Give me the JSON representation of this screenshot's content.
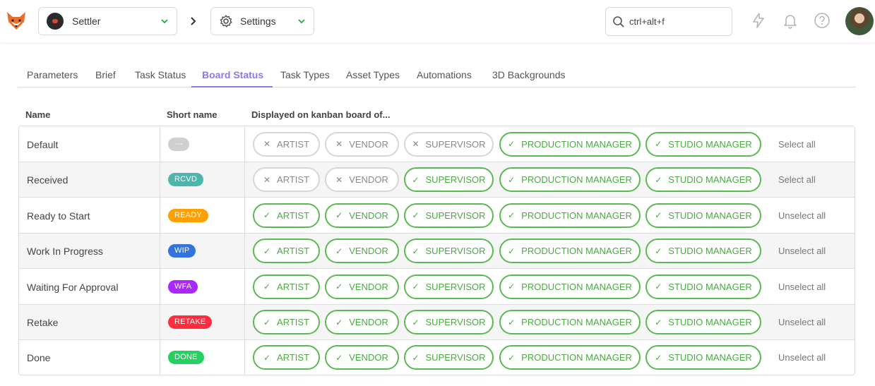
{
  "topbar": {
    "production": "Settler",
    "section": "Settings",
    "search_placeholder": "ctrl+alt+f"
  },
  "tabs": [
    "Parameters",
    "Brief",
    "Task Status",
    "Board Status",
    "Task Types",
    "Asset Types",
    "Automations",
    "3D Backgrounds"
  ],
  "active_tab": "Board Status",
  "table": {
    "headers": {
      "name": "Name",
      "short": "Short name",
      "kanban": "Displayed on kanban board of..."
    },
    "roles": [
      "ARTIST",
      "VENDOR",
      "SUPERVISOR",
      "PRODUCTION MANAGER",
      "STUDIO MANAGER"
    ],
    "rows": [
      {
        "name": "Default",
        "short": "---",
        "color": "#cfcfcf",
        "enabled": [
          false,
          false,
          false,
          true,
          true
        ],
        "action": "Select all"
      },
      {
        "name": "Received",
        "short": "RCVD",
        "color": "#4db6ac",
        "enabled": [
          false,
          false,
          true,
          true,
          true
        ],
        "action": "Select all"
      },
      {
        "name": "Ready to Start",
        "short": "READY",
        "color": "#ff9f00",
        "enabled": [
          true,
          true,
          true,
          true,
          true
        ],
        "action": "Unselect all"
      },
      {
        "name": "Work In Progress",
        "short": "WIP",
        "color": "#3273dc",
        "enabled": [
          true,
          true,
          true,
          true,
          true
        ],
        "action": "Unselect all"
      },
      {
        "name": "Waiting For Approval",
        "short": "WFA",
        "color": "#ab26ff",
        "enabled": [
          true,
          true,
          true,
          true,
          true
        ],
        "action": "Unselect all"
      },
      {
        "name": "Retake",
        "short": "RETAKE",
        "color": "#ff2d3d",
        "enabled": [
          true,
          true,
          true,
          true,
          true
        ],
        "action": "Unselect all"
      },
      {
        "name": "Done",
        "short": "DONE",
        "color": "#22d160",
        "enabled": [
          true,
          true,
          true,
          true,
          true
        ],
        "action": "Unselect all"
      }
    ]
  },
  "colors": {
    "accent": "#8c7ae6",
    "enabled_border": "#5ab950",
    "disabled_border": "#d6d6d6"
  }
}
